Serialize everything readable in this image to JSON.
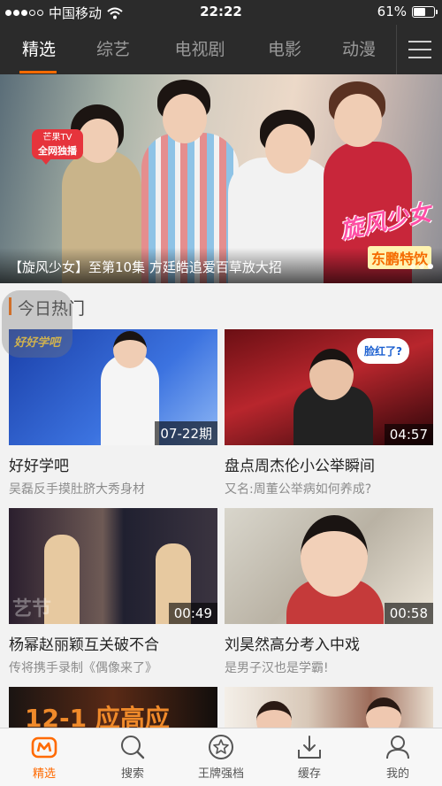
{
  "status_bar": {
    "carrier": "中国移动",
    "time": "22:22",
    "battery": "61%",
    "battery_level": 0.61
  },
  "top_tabs": [
    {
      "label": "精选",
      "active": true
    },
    {
      "label": "综艺",
      "active": false
    },
    {
      "label": "电视剧",
      "active": false
    },
    {
      "label": "电影",
      "active": false
    },
    {
      "label": "动漫",
      "active": false
    }
  ],
  "banner": {
    "tag_line1": "芒果TV",
    "tag_line2": "全网独播",
    "logo": "旋风少女",
    "logo_sub": "东鹏特饮",
    "caption": "【旋风少女】至第10集 方廷皓追爱百草放大招"
  },
  "section": {
    "title": "今日热门"
  },
  "cards": [
    {
      "badge": "07-22期",
      "title": "好好学吧",
      "subtitle": "吴磊反手摸肚脐大秀身材",
      "thumb_text": "好好学吧"
    },
    {
      "badge": "04:57",
      "title": "盘点周杰伦小公举瞬间",
      "subtitle": "又名:周董公举病如何养成?",
      "thumb_text": "脸红了?"
    },
    {
      "badge": "00:49",
      "title": "杨幂赵丽颖互关破不合",
      "subtitle": "传将携手录制《偶像来了》",
      "thumb_text": "艺节"
    },
    {
      "badge": "00:58",
      "title": "刘昊然高分考入中戏",
      "subtitle": "是男子汉也是学霸!",
      "thumb_text": ""
    }
  ],
  "partial_cards": [
    {
      "thumb_text": "12-1 应高应"
    },
    {
      "thumb_text": ""
    }
  ],
  "bottom_tabs": [
    {
      "label": "精选",
      "icon": "featured-icon",
      "active": true
    },
    {
      "label": "搜索",
      "icon": "search-icon",
      "active": false
    },
    {
      "label": "王牌强档",
      "icon": "star-icon",
      "active": false
    },
    {
      "label": "缓存",
      "icon": "download-icon",
      "active": false
    },
    {
      "label": "我的",
      "icon": "user-icon",
      "active": false
    }
  ],
  "colors": {
    "accent": "#ff6a00",
    "nav_bg": "#2b2b2b"
  }
}
